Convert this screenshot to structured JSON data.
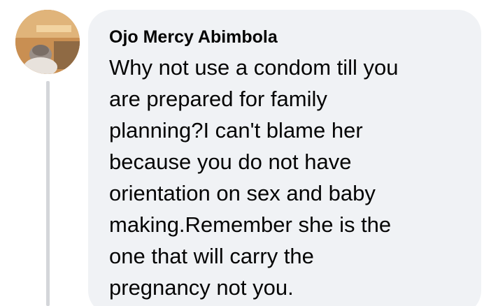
{
  "comment": {
    "author": "Ojo Mercy Abimbola",
    "lines": [
      "Why not use a condom till you",
      "are prepared for family",
      "planning?I can't blame her",
      "because you do not have",
      "orientation on sex and baby",
      "making.Remember she is the",
      "one that will carry the",
      "pregnancy not you."
    ]
  },
  "colors": {
    "bubble": "#f0f2f5",
    "text": "#050505",
    "thread_line": "#d4d6da"
  }
}
